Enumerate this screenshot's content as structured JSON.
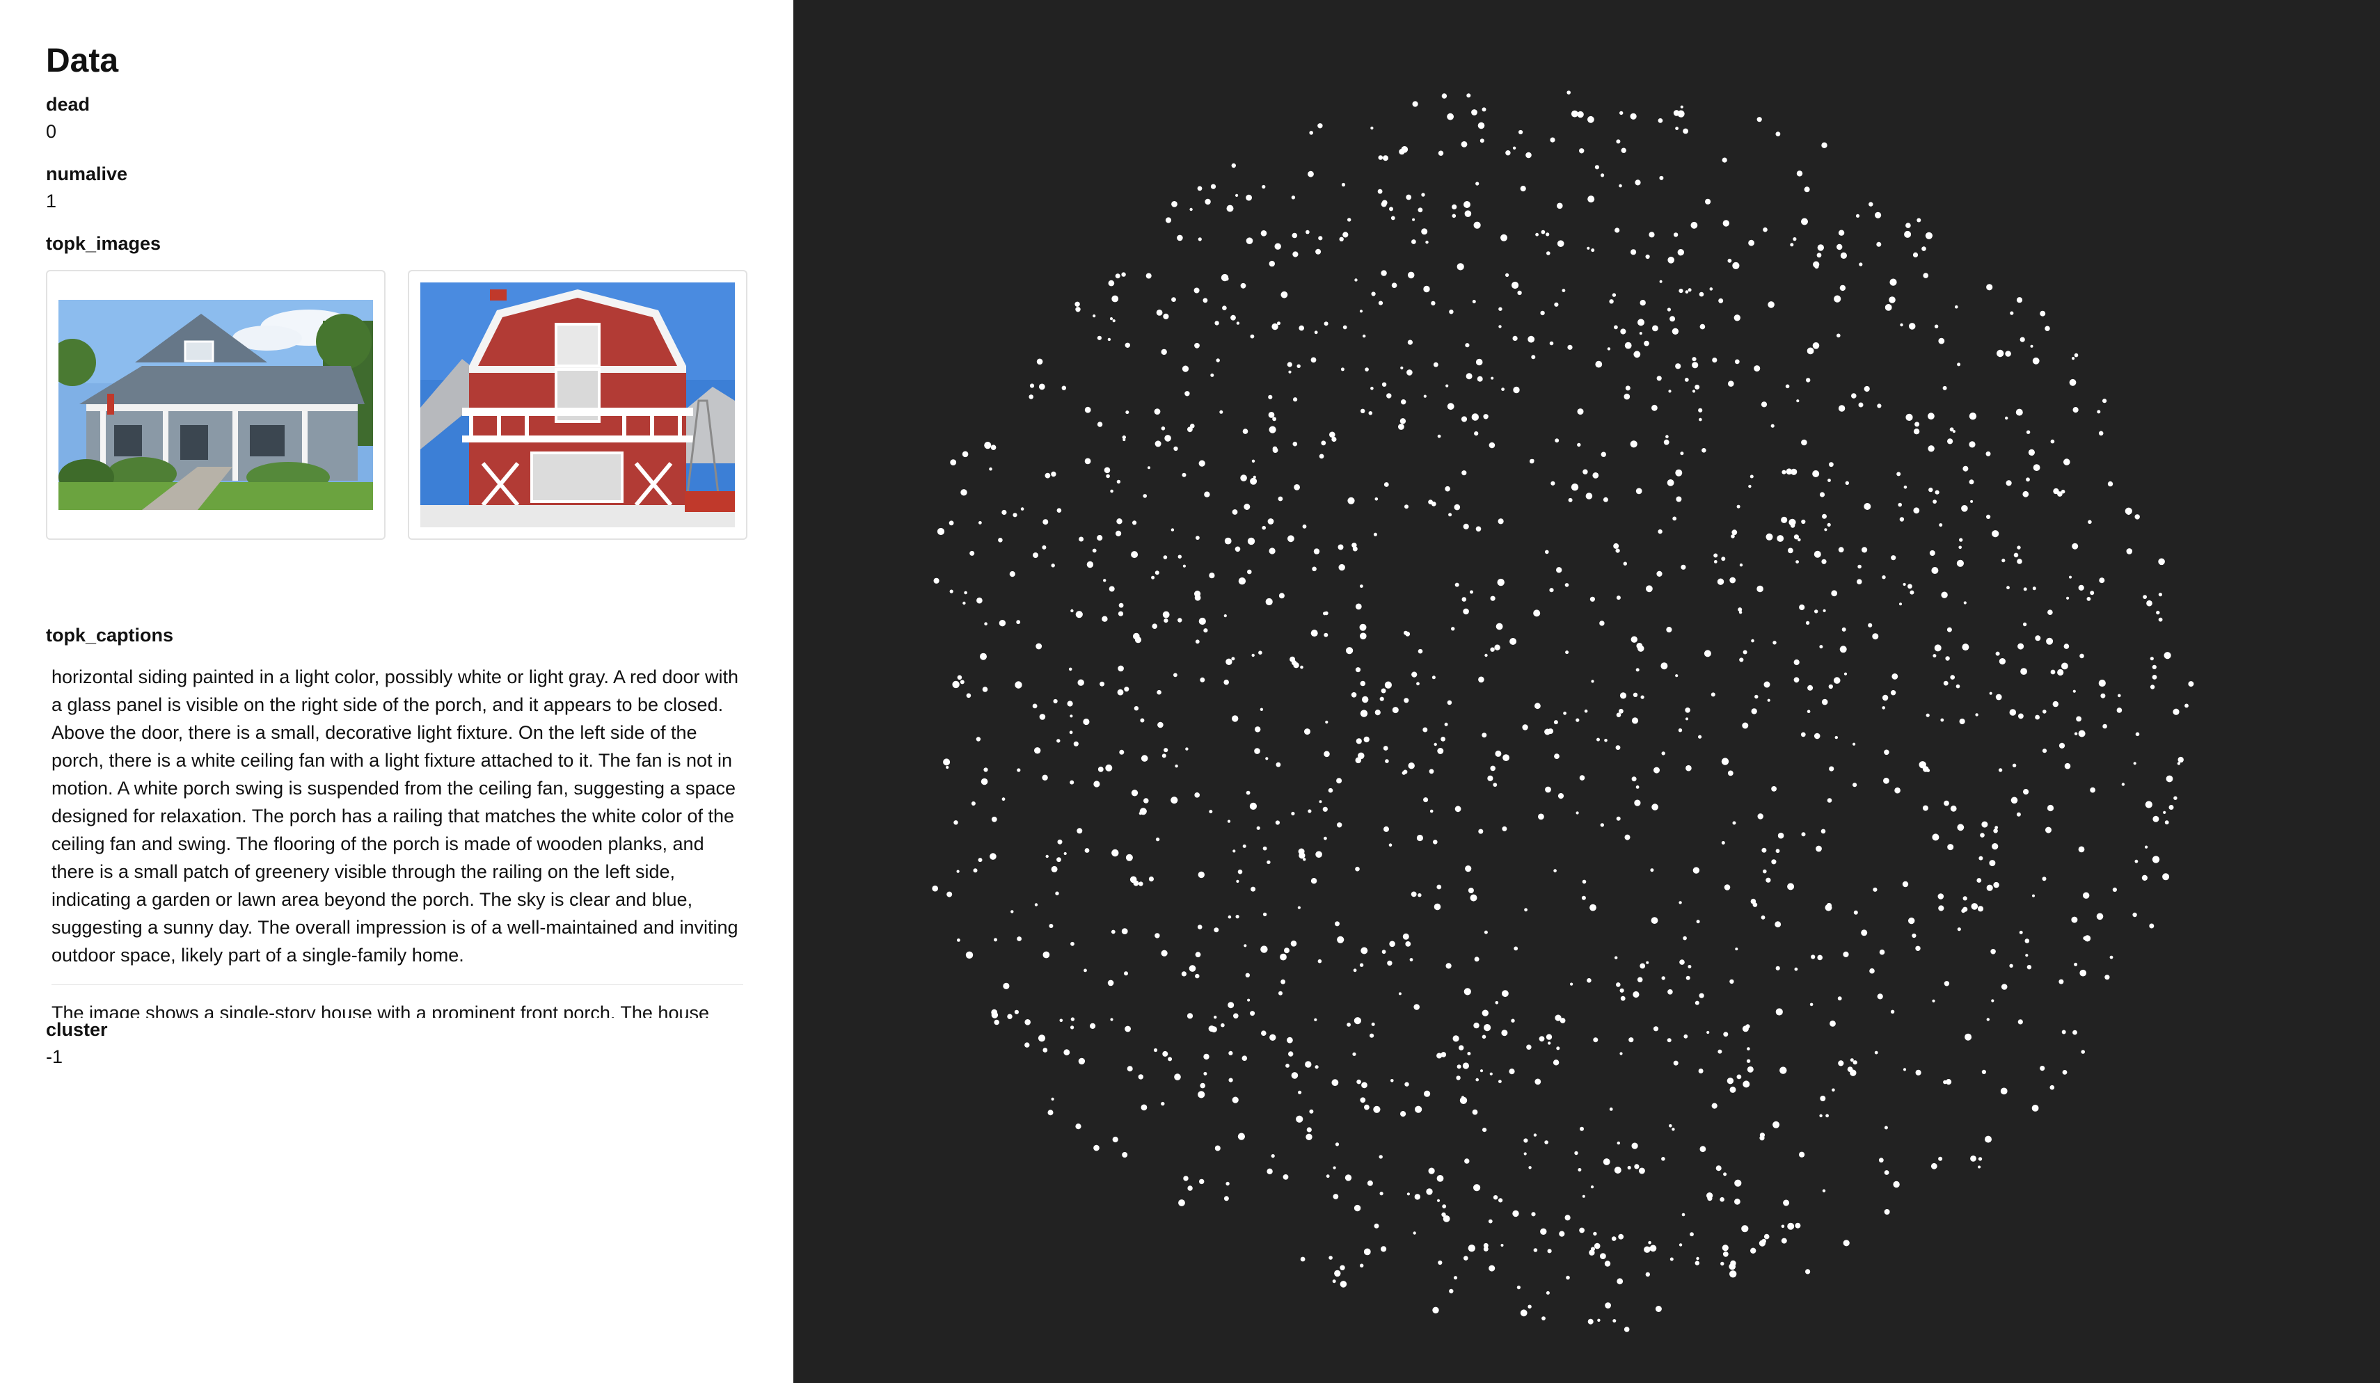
{
  "panel": {
    "title": "Data",
    "fields": {
      "dead": {
        "label": "dead",
        "value": "0"
      },
      "numalive": {
        "label": "numalive",
        "value": "1"
      },
      "topk_images": {
        "label": "topk_images"
      },
      "topk_captions": {
        "label": "topk_captions"
      },
      "cluster": {
        "label": "cluster",
        "value": "-1"
      }
    },
    "captions": [
      "horizontal siding painted in a light color, possibly white or light gray. A red door with a glass panel is visible on the right side of the porch, and it appears to be closed. Above the door, there is a small, decorative light fixture. On the left side of the porch, there is a white ceiling fan with a light fixture attached to it. The fan is not in motion. A white porch swing is suspended from the ceiling fan, suggesting a space designed for relaxation. The porch has a railing that matches the white color of the ceiling fan and swing. The flooring of the porch is made of wooden planks, and there is a small patch of greenery visible through the railing on the left side, indicating a garden or lawn area beyond the porch. The sky is clear and blue, suggesting a sunny day. The overall impression is of a well-maintained and inviting outdoor space, likely part of a single-family home.",
      "The image shows a single-story house with a prominent front porch. The house"
    ],
    "images": [
      {
        "name": "house-photo-gray-porch"
      },
      {
        "name": "house-photo-red-barn"
      }
    ]
  },
  "scatter": {
    "background": "#222222",
    "point_color": "#ffffff"
  }
}
